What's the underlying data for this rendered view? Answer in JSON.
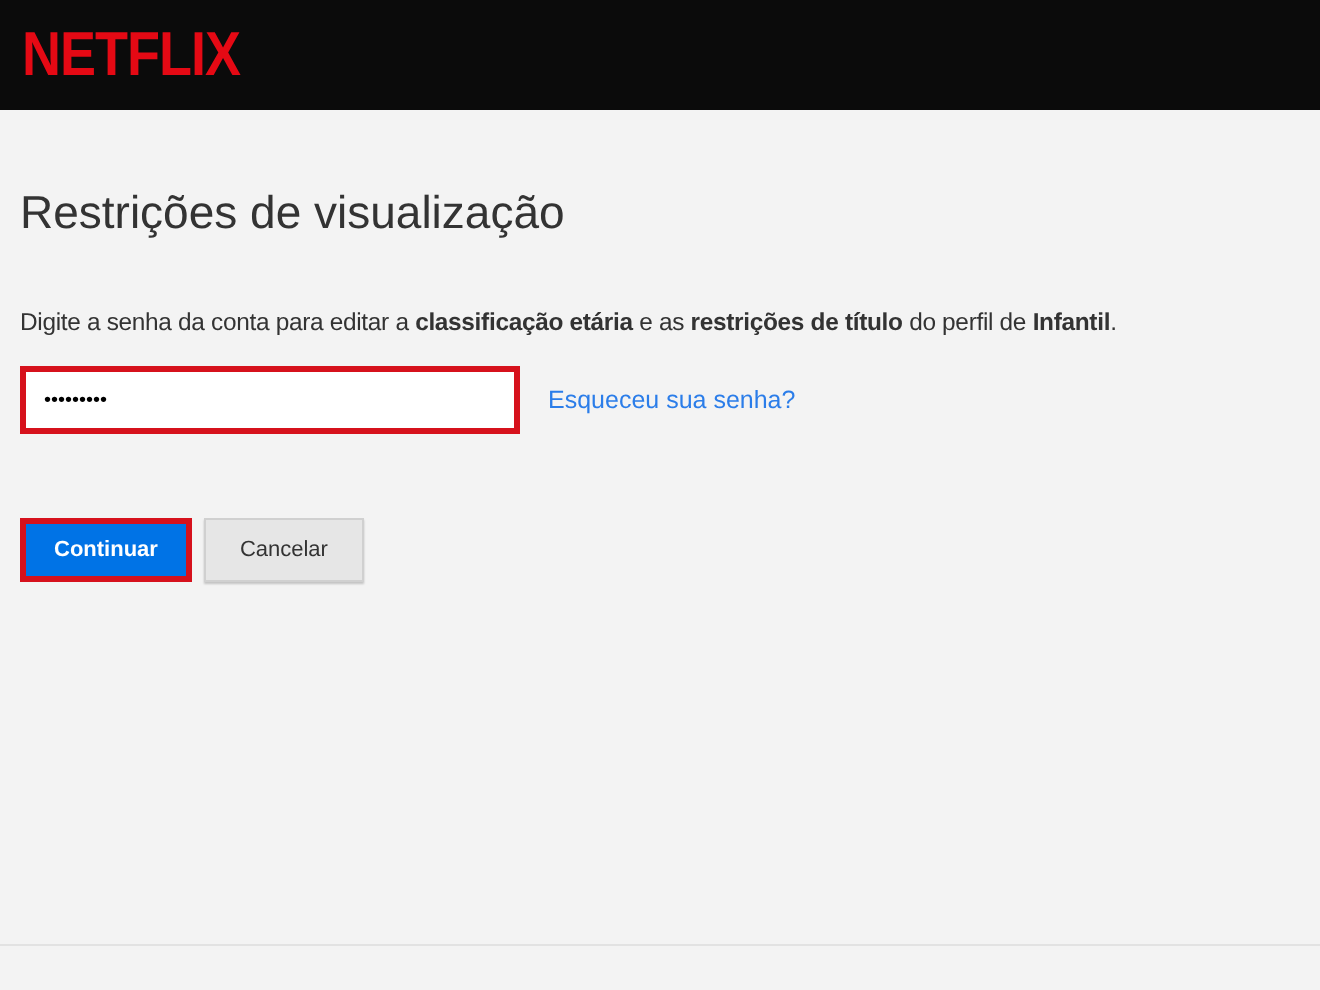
{
  "header": {
    "logo": "NETFLIX"
  },
  "title": "Restrições de visualização",
  "description": "Digite a senha da conta para editar a **classificação etária** e as **restrições de título** do perfil de **Infantil**.",
  "password_field": {
    "value": "•••••••••",
    "highlighted": true
  },
  "forgot_link": "Esqueceu sua senha?",
  "buttons": [
    {
      "label": "Continuar",
      "kind": "primary",
      "highlighted": true
    },
    {
      "label": "Cancelar",
      "kind": "secondary",
      "highlighted": false
    }
  ]
}
